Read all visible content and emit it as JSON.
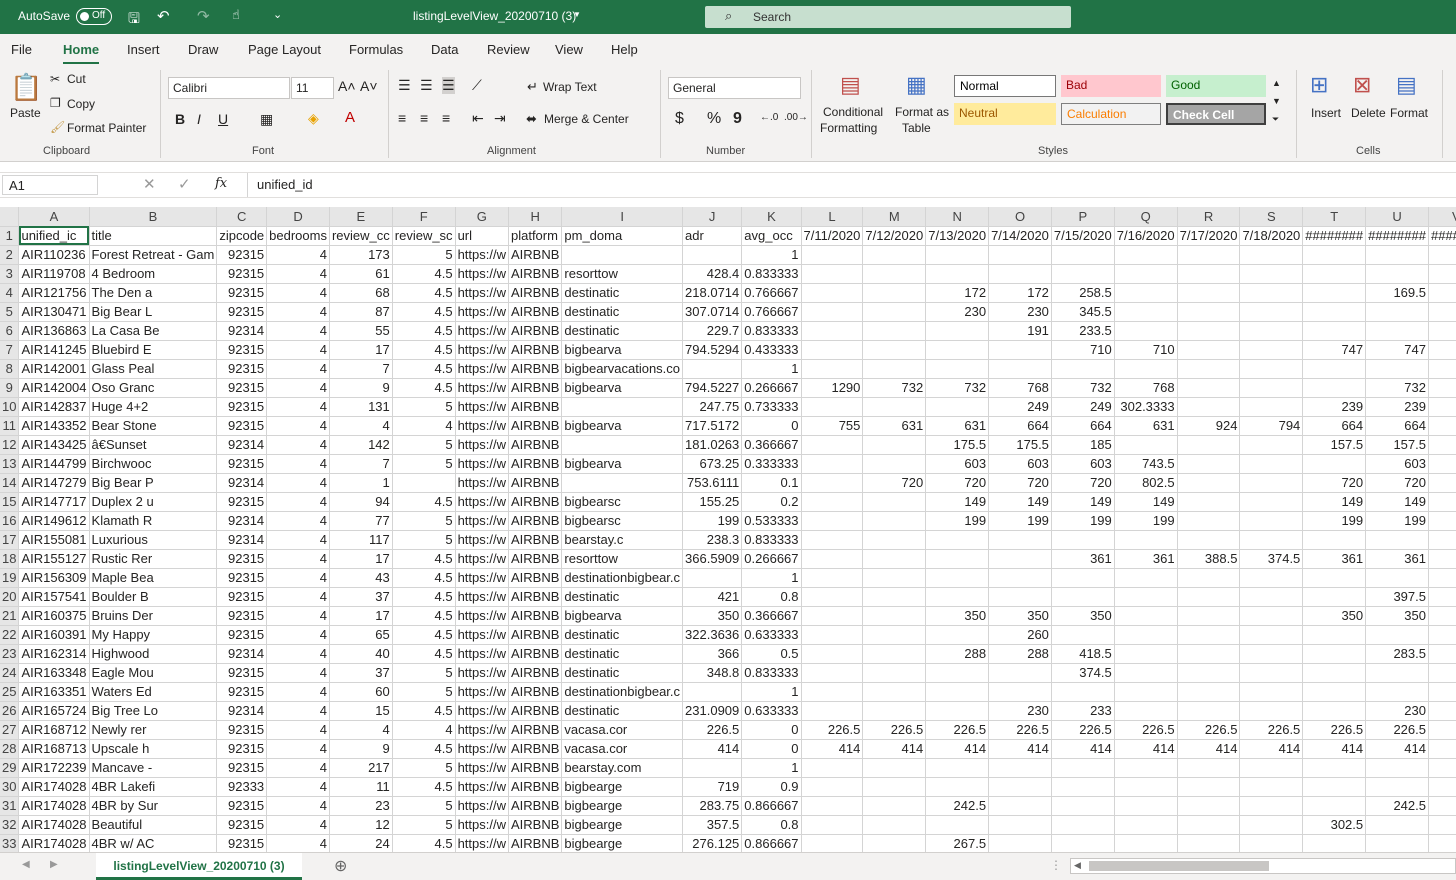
{
  "titlebar": {
    "autosave_label": "AutoSave",
    "autosave_state": "Off",
    "filename": "listingLevelView_20200710 (3)",
    "search_placeholder": "Search"
  },
  "menu": [
    "File",
    "Home",
    "Insert",
    "Draw",
    "Page Layout",
    "Formulas",
    "Data",
    "Review",
    "View",
    "Help"
  ],
  "ribbon": {
    "clipboard": {
      "paste": "Paste",
      "cut": "Cut",
      "copy": "Copy",
      "format_painter": "Format Painter",
      "group": "Clipboard"
    },
    "font": {
      "name": "Calibri",
      "size": "11",
      "group": "Font",
      "bold": "B",
      "italic": "I",
      "underline": "U"
    },
    "alignment": {
      "wrap": "Wrap Text",
      "merge": "Merge & Center",
      "group": "Alignment"
    },
    "number": {
      "format": "General",
      "currency": "$",
      "percent": "%",
      "comma": "9",
      "group": "Number"
    },
    "styles": {
      "conditional": "Conditional",
      "conditional2": "Formatting",
      "format_as": "Format as",
      "table": "Table",
      "group": "Styles",
      "cells": [
        {
          "label": "Normal",
          "bg": "#ffffff",
          "fg": "#000000"
        },
        {
          "label": "Bad",
          "bg": "#ffc7ce",
          "fg": "#9c0006"
        },
        {
          "label": "Good",
          "bg": "#c6efce",
          "fg": "#006100"
        },
        {
          "label": "Neutral",
          "bg": "#ffeb9c",
          "fg": "#9c5700"
        },
        {
          "label": "Calculation",
          "bg": "#f2f2f2",
          "fg": "#fa7d00"
        },
        {
          "label": "Check Cell",
          "bg": "#a5a5a5",
          "fg": "#ffffff"
        }
      ]
    },
    "cells": {
      "insert": "Insert",
      "delete": "Delete",
      "format": "Format",
      "group": "Cells"
    }
  },
  "formula_bar": {
    "name_box": "A1",
    "fx": "fx",
    "value": "unified_id"
  },
  "columns": [
    "A",
    "B",
    "C",
    "D",
    "E",
    "F",
    "G",
    "H",
    "I",
    "J",
    "K",
    "L",
    "M",
    "N",
    "O",
    "P",
    "Q",
    "R",
    "S",
    "T",
    "U",
    "V"
  ],
  "rows": [
    [
      "unified_ic",
      "title",
      "zipcode",
      "bedrooms",
      "review_cc",
      "review_sc",
      "url",
      "platform",
      "pm_doma",
      "adr",
      "avg_occ",
      "7/11/2020",
      "7/12/2020",
      "7/13/2020",
      "7/14/2020",
      "7/15/2020",
      "7/16/2020",
      "7/17/2020",
      "7/18/2020",
      "########",
      "########",
      "#######"
    ],
    [
      "AIR110236",
      "Forest Retreat - Gam",
      "92315",
      "4",
      "173",
      "5",
      "https://w",
      "AIRBNB",
      "",
      "",
      "1",
      "",
      "",
      "",
      "",
      "",
      "",
      "",
      "",
      "",
      "",
      ""
    ],
    [
      "AIR119708",
      "4 Bedroom",
      "92315",
      "4",
      "61",
      "4.5",
      "https://w",
      "AIRBNB",
      "resorttow",
      "428.4",
      "0.833333",
      "",
      "",
      "",
      "",
      "",
      "",
      "",
      "",
      "",
      "",
      ""
    ],
    [
      "AIR121756",
      "The Den a",
      "92315",
      "4",
      "68",
      "4.5",
      "https://w",
      "AIRBNB",
      "destinatic",
      "218.0714",
      "0.766667",
      "",
      "",
      "172",
      "172",
      "258.5",
      "",
      "",
      "",
      "",
      "169.5",
      "16"
    ],
    [
      "AIR130471",
      "Big Bear L",
      "92315",
      "4",
      "87",
      "4.5",
      "https://w",
      "AIRBNB",
      "destinatic",
      "307.0714",
      "0.766667",
      "",
      "",
      "230",
      "230",
      "345.5",
      "",
      "",
      "",
      "",
      "",
      ""
    ],
    [
      "AIR136863",
      "La Casa Be",
      "92314",
      "4",
      "55",
      "4.5",
      "https://w",
      "AIRBNB",
      "destinatic",
      "229.7",
      "0.833333",
      "",
      "",
      "",
      "191",
      "233.5",
      "",
      "",
      "",
      "",
      "",
      "18"
    ],
    [
      "AIR141245",
      "Bluebird E",
      "92315",
      "4",
      "17",
      "4.5",
      "https://w",
      "AIRBNB",
      "bigbearva",
      "794.5294",
      "0.433333",
      "",
      "",
      "",
      "",
      "710",
      "710",
      "",
      "",
      "747",
      "747",
      "74"
    ],
    [
      "AIR142001",
      "Glass Peal",
      "92315",
      "4",
      "7",
      "4.5",
      "https://w",
      "AIRBNB",
      "bigbearvacations.co",
      "",
      "1",
      "",
      "",
      "",
      "",
      "",
      "",
      "",
      "",
      "",
      "",
      ""
    ],
    [
      "AIR142004",
      "Oso Granc",
      "92315",
      "4",
      "9",
      "4.5",
      "https://w",
      "AIRBNB",
      "bigbearva",
      "794.5227",
      "0.266667",
      "1290",
      "732",
      "732",
      "768",
      "732",
      "768",
      "",
      "",
      "",
      "732",
      "73"
    ],
    [
      "AIR142837",
      "Huge 4+2",
      "92315",
      "4",
      "131",
      "5",
      "https://w",
      "AIRBNB",
      "",
      "247.75",
      "0.733333",
      "",
      "",
      "",
      "249",
      "249",
      "302.3333",
      "",
      "",
      "239",
      "239",
      "23"
    ],
    [
      "AIR143352",
      "Bear Stone",
      "92315",
      "4",
      "4",
      "4",
      "https://w",
      "AIRBNB",
      "bigbearva",
      "717.5172",
      "0",
      "755",
      "631",
      "631",
      "664",
      "664",
      "631",
      "924",
      "794",
      "664",
      "664",
      "66"
    ],
    [
      "AIR143425",
      "â€Sunset",
      "92314",
      "4",
      "142",
      "5",
      "https://w",
      "AIRBNB",
      "",
      "181.0263",
      "0.366667",
      "",
      "",
      "175.5",
      "175.5",
      "185",
      "",
      "",
      "",
      "157.5",
      "157.5",
      "157"
    ],
    [
      "AIR144799",
      "Birchwooc",
      "92315",
      "4",
      "7",
      "5",
      "https://w",
      "AIRBNB",
      "bigbearva",
      "673.25",
      "0.333333",
      "",
      "",
      "603",
      "603",
      "603",
      "743.5",
      "",
      "",
      "",
      "603",
      "60"
    ],
    [
      "AIR147279",
      "Big Bear P",
      "92314",
      "4",
      "1",
      "",
      "https://w",
      "AIRBNB",
      "",
      "753.6111",
      "0.1",
      "",
      "720",
      "720",
      "720",
      "720",
      "802.5",
      "",
      "",
      "720",
      "720",
      "72"
    ],
    [
      "AIR147717",
      "Duplex 2 u",
      "92315",
      "4",
      "94",
      "4.5",
      "https://w",
      "AIRBNB",
      "bigbearsc",
      "155.25",
      "0.2",
      "",
      "",
      "149",
      "149",
      "149",
      "149",
      "",
      "",
      "149",
      "149",
      "14"
    ],
    [
      "AIR149612",
      "Klamath R",
      "92314",
      "4",
      "77",
      "5",
      "https://w",
      "AIRBNB",
      "bigbearsc",
      "199",
      "0.533333",
      "",
      "",
      "199",
      "199",
      "199",
      "199",
      "",
      "",
      "199",
      "199",
      "19"
    ],
    [
      "AIR155081",
      "Luxurious",
      "92314",
      "4",
      "117",
      "5",
      "https://w",
      "AIRBNB",
      "bearstay.c",
      "238.3",
      "0.833333",
      "",
      "",
      "",
      "",
      "",
      "",
      "",
      "",
      "",
      "",
      "210"
    ],
    [
      "AIR155127",
      "Rustic Rer",
      "92315",
      "4",
      "17",
      "4.5",
      "https://w",
      "AIRBNB",
      "resorttow",
      "366.5909",
      "0.266667",
      "",
      "",
      "",
      "",
      "361",
      "361",
      "388.5",
      "374.5",
      "361",
      "361",
      "36"
    ],
    [
      "AIR156309",
      "Maple Bea",
      "92315",
      "4",
      "43",
      "4.5",
      "https://w",
      "AIRBNB",
      "destinationbigbear.c",
      "",
      "1",
      "",
      "",
      "",
      "",
      "",
      "",
      "",
      "",
      "",
      "",
      ""
    ],
    [
      "AIR157541",
      "Boulder B",
      "92315",
      "4",
      "37",
      "4.5",
      "https://w",
      "AIRBNB",
      "destinatic",
      "421",
      "0.8",
      "",
      "",
      "",
      "",
      "",
      "",
      "",
      "",
      "",
      "397.5",
      "39"
    ],
    [
      "AIR160375",
      "Bruins Der",
      "92315",
      "4",
      "17",
      "4.5",
      "https://w",
      "AIRBNB",
      "bigbearva",
      "350",
      "0.366667",
      "",
      "",
      "350",
      "350",
      "350",
      "",
      "",
      "",
      "350",
      "350",
      "35"
    ],
    [
      "AIR160391",
      "My Happy",
      "92315",
      "4",
      "65",
      "4.5",
      "https://w",
      "AIRBNB",
      "destinatic",
      "322.3636",
      "0.633333",
      "",
      "",
      "",
      "260",
      "",
      "",
      "",
      "",
      "",
      "",
      ""
    ],
    [
      "AIR162314",
      "Highwood",
      "92314",
      "4",
      "40",
      "4.5",
      "https://w",
      "AIRBNB",
      "destinatic",
      "366",
      "0.5",
      "",
      "",
      "288",
      "288",
      "418.5",
      "",
      "",
      "",
      "",
      "283.5",
      "27"
    ],
    [
      "AIR163348",
      "Eagle Mou",
      "92315",
      "4",
      "37",
      "5",
      "https://w",
      "AIRBNB",
      "destinatic",
      "348.8",
      "0.833333",
      "",
      "",
      "",
      "",
      "374.5",
      "",
      "",
      "",
      "",
      "",
      ""
    ],
    [
      "AIR163351",
      "Waters Ed",
      "92315",
      "4",
      "60",
      "5",
      "https://w",
      "AIRBNB",
      "destinationbigbear.c",
      "",
      "1",
      "",
      "",
      "",
      "",
      "",
      "",
      "",
      "",
      "",
      "",
      ""
    ],
    [
      "AIR165724",
      "Big Tree Lo",
      "92314",
      "4",
      "15",
      "4.5",
      "https://w",
      "AIRBNB",
      "destinatic",
      "231.0909",
      "0.633333",
      "",
      "",
      "",
      "230",
      "233",
      "",
      "",
      "",
      "",
      "230",
      "23"
    ],
    [
      "AIR168712",
      "Newly rer",
      "92315",
      "4",
      "4",
      "4",
      "https://w",
      "AIRBNB",
      "vacasa.cor",
      "226.5",
      "0",
      "226.5",
      "226.5",
      "226.5",
      "226.5",
      "226.5",
      "226.5",
      "226.5",
      "226.5",
      "226.5",
      "226.5",
      "226"
    ],
    [
      "AIR168713",
      "Upscale h",
      "92315",
      "4",
      "9",
      "4.5",
      "https://w",
      "AIRBNB",
      "vacasa.cor",
      "414",
      "0",
      "414",
      "414",
      "414",
      "414",
      "414",
      "414",
      "414",
      "414",
      "414",
      "414",
      "41"
    ],
    [
      "AIR172239",
      "Mancave -",
      "92315",
      "4",
      "217",
      "5",
      "https://w",
      "AIRBNB",
      "bearstay.com",
      "",
      "1",
      "",
      "",
      "",
      "",
      "",
      "",
      "",
      "",
      "",
      "",
      ""
    ],
    [
      "AIR174028",
      "4BR Lakefi",
      "92333",
      "4",
      "11",
      "4.5",
      "https://w",
      "AIRBNB",
      "bigbearge",
      "719",
      "0.9",
      "",
      "",
      "",
      "",
      "",
      "",
      "",
      "",
      "",
      "",
      ""
    ],
    [
      "AIR174028",
      "4BR by Sur",
      "92315",
      "4",
      "23",
      "5",
      "https://w",
      "AIRBNB",
      "bigbearge",
      "283.75",
      "0.866667",
      "",
      "",
      "242.5",
      "",
      "",
      "",
      "",
      "",
      "",
      "242.5",
      ""
    ],
    [
      "AIR174028",
      "Beautiful",
      "92315",
      "4",
      "12",
      "5",
      "https://w",
      "AIRBNB",
      "bigbearge",
      "357.5",
      "0.8",
      "",
      "",
      "",
      "",
      "",
      "",
      "",
      "",
      "302.5",
      "",
      ""
    ],
    [
      "AIR174028",
      "4BR w/ AC",
      "92315",
      "4",
      "24",
      "4.5",
      "https://w",
      "AIRBNB",
      "bigbearge",
      "276.125",
      "0.866667",
      "",
      "",
      "267.5",
      "",
      "",
      "",
      "",
      "",
      "",
      "",
      ""
    ]
  ],
  "sheet_tab": "listingLevelView_20200710 (3)"
}
